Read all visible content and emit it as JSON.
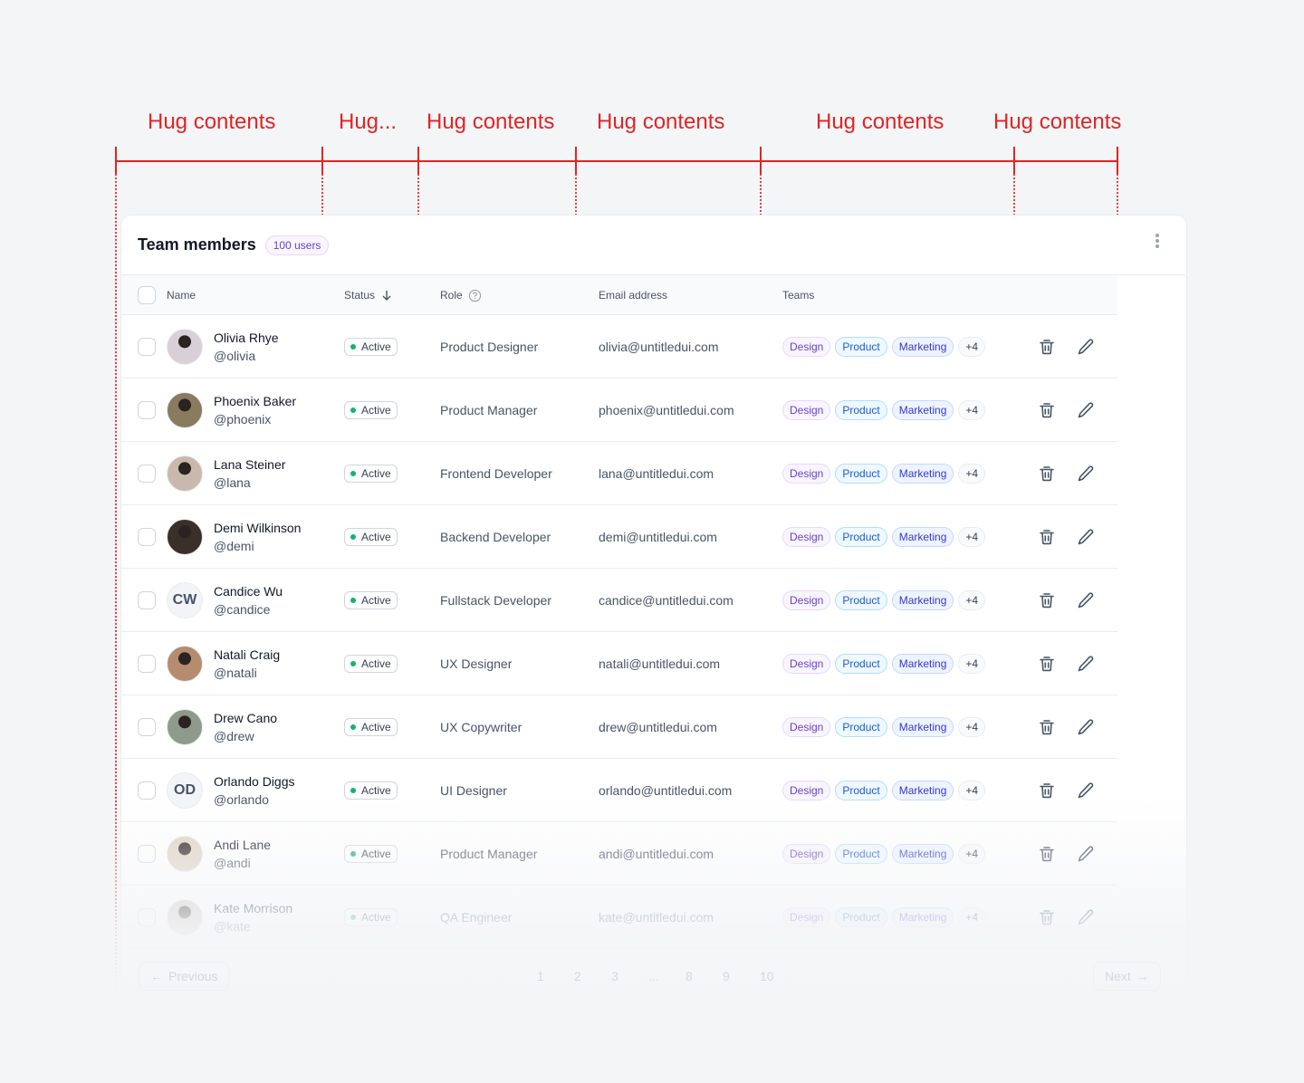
{
  "annotations": [
    "Hug contents",
    "Hug...",
    "Hug contents",
    "Hug contents",
    "Hug contents",
    "Hug contents"
  ],
  "header": {
    "title": "Team members",
    "count": "100 users"
  },
  "columns": {
    "name": "Name",
    "status": "Status",
    "role": "Role",
    "email": "Email address",
    "teams": "Teams"
  },
  "rows": [
    {
      "name": "Olivia Rhye",
      "handle": "@olivia",
      "status": "Active",
      "role": "Product Designer",
      "email": "olivia@untitledui.com",
      "avatar_color": "#d9cfd6"
    },
    {
      "name": "Phoenix Baker",
      "handle": "@phoenix",
      "status": "Active",
      "role": "Product Manager",
      "email": "phoenix@untitledui.com",
      "avatar_color": "#8a7a5e"
    },
    {
      "name": "Lana Steiner",
      "handle": "@lana",
      "status": "Active",
      "role": "Frontend Developer",
      "email": "lana@untitledui.com",
      "avatar_color": "#c9b9ad"
    },
    {
      "name": "Demi Wilkinson",
      "handle": "@demi",
      "status": "Active",
      "role": "Backend Developer",
      "email": "demi@untitledui.com",
      "avatar_color": "#3b2f2a"
    },
    {
      "name": "Candice Wu",
      "handle": "@candice",
      "status": "Active",
      "role": "Fullstack Developer",
      "email": "candice@untitledui.com",
      "initials": "CW"
    },
    {
      "name": "Natali Craig",
      "handle": "@natali",
      "status": "Active",
      "role": "UX Designer",
      "email": "natali@untitledui.com",
      "avatar_color": "#b58c6e"
    },
    {
      "name": "Drew Cano",
      "handle": "@drew",
      "status": "Active",
      "role": "UX Copywriter",
      "email": "drew@untitledui.com",
      "avatar_color": "#8e9a8a"
    },
    {
      "name": "Orlando Diggs",
      "handle": "@orlando",
      "status": "Active",
      "role": "UI Designer",
      "email": "orlando@untitledui.com",
      "initials": "OD"
    },
    {
      "name": "Andi Lane",
      "handle": "@andi",
      "status": "Active",
      "role": "Product Manager",
      "email": "andi@untitledui.com",
      "avatar_color": "#e0d2c2"
    },
    {
      "name": "Kate Morrison",
      "handle": "@kate",
      "status": "Active",
      "role": "QA Engineer",
      "email": "kate@untitledui.com",
      "avatar_color": "#cfc6c2"
    }
  ],
  "teams": [
    "Design",
    "Product",
    "Marketing",
    "+4"
  ],
  "pagination": {
    "previous": "Previous",
    "next": "Next",
    "pages": [
      "1",
      "2",
      "3",
      "...",
      "8",
      "9",
      "10"
    ]
  },
  "colors": {
    "annotation": "#e02424",
    "active": "#17b26a",
    "accent": "#6941c6"
  }
}
